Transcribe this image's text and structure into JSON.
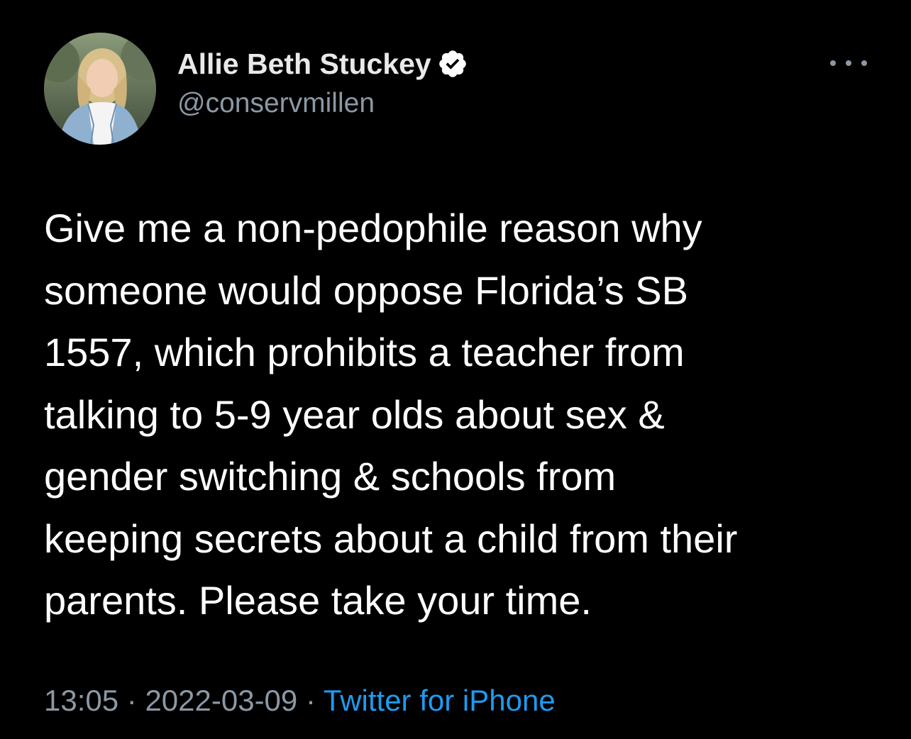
{
  "colors": {
    "background": "#000000",
    "text_primary": "#ffffff",
    "text_secondary": "#8b98a5",
    "link": "#1d9bf0",
    "verified_badge": "#ffffff"
  },
  "author": {
    "display_name": "Allie Beth Stuckey",
    "handle": "@conservmillen",
    "verified": true,
    "avatar_icon": "profile-photo",
    "badge_icon": "verified-badge-icon"
  },
  "actions": {
    "more_icon": "more-options-icon"
  },
  "tweet": {
    "lines": [
      "Give me a non-pedophile reason why",
      "someone would oppose Florida’s SB",
      "1557, which prohibits a teacher from",
      "talking to 5-9 year olds about sex &",
      "gender switching & schools from",
      "keeping secrets about a child from their",
      "parents. Please take your time."
    ]
  },
  "meta": {
    "time": "13:05",
    "separator": "·",
    "date": "2022-03-09",
    "source": "Twitter for iPhone"
  }
}
